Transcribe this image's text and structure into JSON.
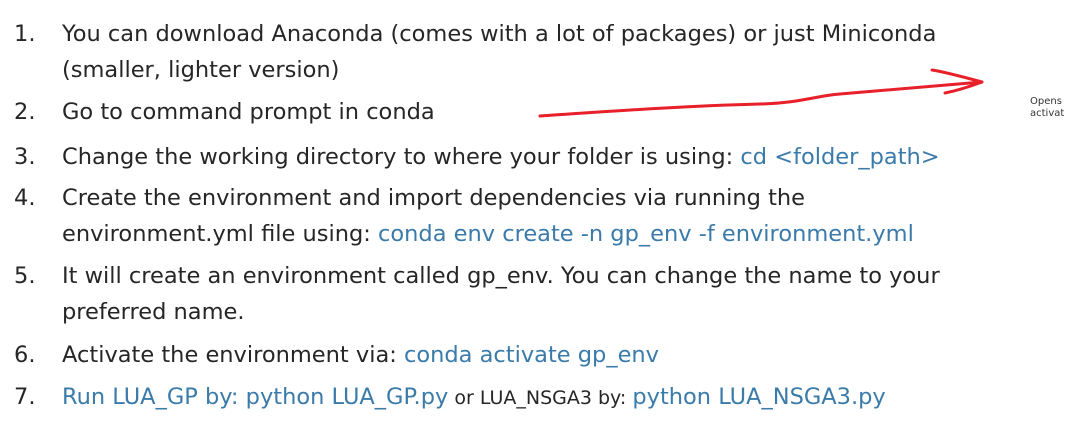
{
  "steps": [
    {
      "num": "1.",
      "parts": [
        {
          "text": "You can download Anaconda (comes with a lot of packages) or just Miniconda",
          "style": "plain"
        }
      ],
      "cont": "(smaller, lighter version)"
    },
    {
      "num": "2.",
      "parts": [
        {
          "text": "Go to command prompt in conda",
          "style": "plain"
        }
      ]
    },
    {
      "num": "3.",
      "parts": [
        {
          "text": "Change the working directory to where your folder is using: ",
          "style": "plain"
        },
        {
          "text": "cd <folder_path>",
          "style": "code"
        }
      ]
    },
    {
      "num": "4.",
      "parts": [
        {
          "text": "Create the environment and import dependencies via running the",
          "style": "plain"
        }
      ],
      "cont_parts": [
        {
          "text": "environment.yml file using:  ",
          "style": "plain"
        },
        {
          "text": "conda env create -n gp_env -f environment.yml",
          "style": "code"
        }
      ]
    },
    {
      "num": "5.",
      "parts": [
        {
          "text": "It will create an environment called gp_env. You can change the name to your",
          "style": "plain"
        }
      ],
      "cont": "preferred name."
    },
    {
      "num": "6.",
      "parts": [
        {
          "text": "Activate the environment via: ",
          "style": "plain"
        },
        {
          "text": "conda activate gp_env",
          "style": "code"
        }
      ]
    },
    {
      "num": "7.",
      "parts": [
        {
          "text": "Run LUA_GP by: ",
          "style": "code"
        },
        {
          "text": "python LUA_GP.py",
          "style": "code"
        },
        {
          "text": "  or LUA_NSGA3 by: ",
          "style": "small"
        },
        {
          "text": "python LUA_NSGA3.py",
          "style": "code"
        }
      ]
    }
  ],
  "annotation": {
    "tooltip_line1": "Opens",
    "tooltip_line2": "activat",
    "arrow_color": "#e8202a"
  }
}
